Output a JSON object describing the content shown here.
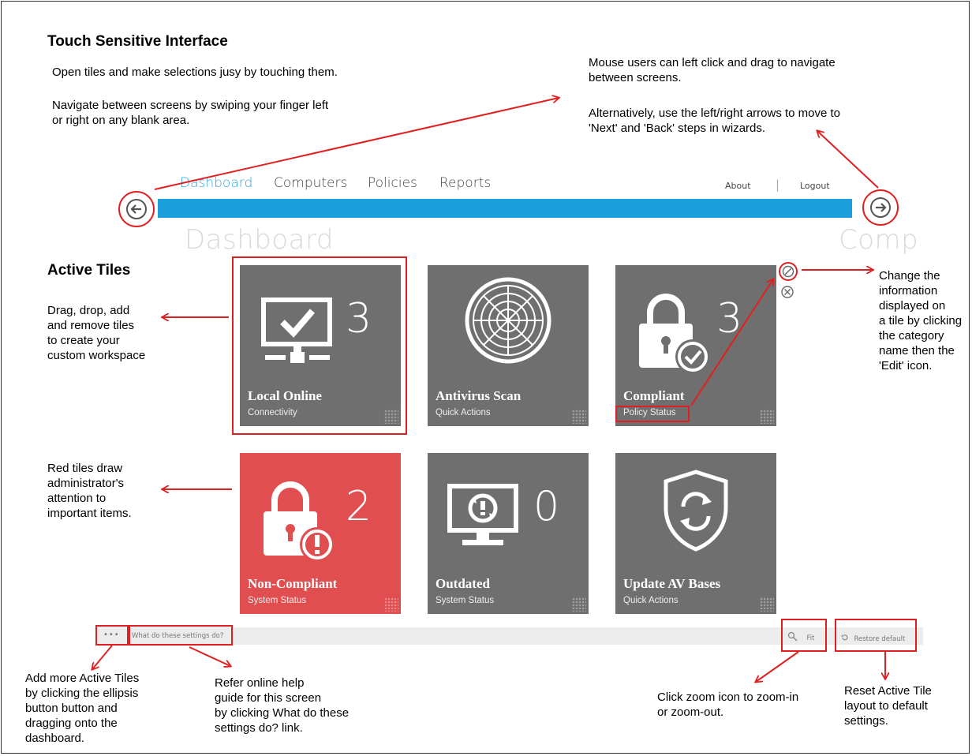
{
  "top": {
    "heading": "Touch Sensitive Interface",
    "touch_line1": "Open tiles and make selections jusy by touching them.",
    "touch_line2": "Navigate between screens by swiping your finger left",
    "touch_line3": "or right on any blank area.",
    "mouse_line1": "Mouse users can left click and drag to navigate",
    "mouse_line2": "between screens.",
    "mouse_line3": "Alternatively, use the left/right arrows to move to",
    "mouse_line4": "'Next' and 'Back' steps in wizards."
  },
  "nav": {
    "items": [
      {
        "label": "Dashboard"
      },
      {
        "label": "Computers"
      },
      {
        "label": "Policies"
      },
      {
        "label": "Reports"
      }
    ],
    "about": "About",
    "separator": "|",
    "logout": "Logout",
    "page_ghost": "Dashboard",
    "next_ghost": "Comp"
  },
  "left_notes": {
    "active_tiles": "Active Tiles",
    "drag_1": "Drag, drop, add",
    "drag_2": "and remove tiles",
    "drag_3": "to create your",
    "drag_4": "custom workspace",
    "red_1": "Red tiles draw",
    "red_2": "administrator's",
    "red_3": "attention to",
    "red_4": "important items."
  },
  "right_notes": {
    "l1": "Change the",
    "l2": "information",
    "l3": "displayed on",
    "l4": "a tile by clicking",
    "l5": "the category",
    "l6": "name then the",
    "l7": "'Edit' icon."
  },
  "tiles": [
    {
      "name": "Local Online",
      "category": "Connectivity",
      "count": "3",
      "color": "#6f6f6f",
      "icon": "monitor-check-icon"
    },
    {
      "name": "Antivirus Scan",
      "category": "Quick Actions",
      "count": "",
      "color": "#6f6f6f",
      "icon": "radar-icon"
    },
    {
      "name": "Compliant",
      "category": "Policy Status",
      "count": "3",
      "color": "#6f6f6f",
      "icon": "lock-check-icon"
    },
    {
      "name": "Non-Compliant",
      "category": "System Status",
      "count": "2",
      "color": "#e04e50",
      "icon": "lock-alert-icon"
    },
    {
      "name": "Outdated",
      "category": "System Status",
      "count": "0",
      "color": "#6f6f6f",
      "icon": "monitor-refresh-icon"
    },
    {
      "name": "Update AV Bases",
      "category": "Quick Actions",
      "count": "",
      "color": "#6f6f6f",
      "icon": "shield-refresh-icon"
    }
  ],
  "bottom_bar": {
    "ellipsis": "•••",
    "help_link": "What do these settings do?",
    "fit": "Fit",
    "restore": "Restore default"
  },
  "bottom_notes": {
    "add_1": "Add more Active Tiles",
    "add_2": "by clicking the ellipsis",
    "add_3": "button button and",
    "add_4": "dragging onto the",
    "add_5": "dashboard.",
    "help_1": "Refer online help",
    "help_2": "guide for this screen",
    "help_3": "by clicking What do these",
    "help_4": "settings do? link.",
    "zoom_1": "Click zoom icon to zoom-in",
    "zoom_2": "or zoom-out.",
    "reset_1": "Reset Active Tile",
    "reset_2": "layout to default",
    "reset_3": "settings."
  },
  "colors": {
    "accent_bar": "#1a9fdb",
    "tile_gray": "#6f6f6f",
    "tile_red": "#e04e50",
    "annotation_red": "#e02020",
    "active_nav": "#2ea4dd"
  }
}
